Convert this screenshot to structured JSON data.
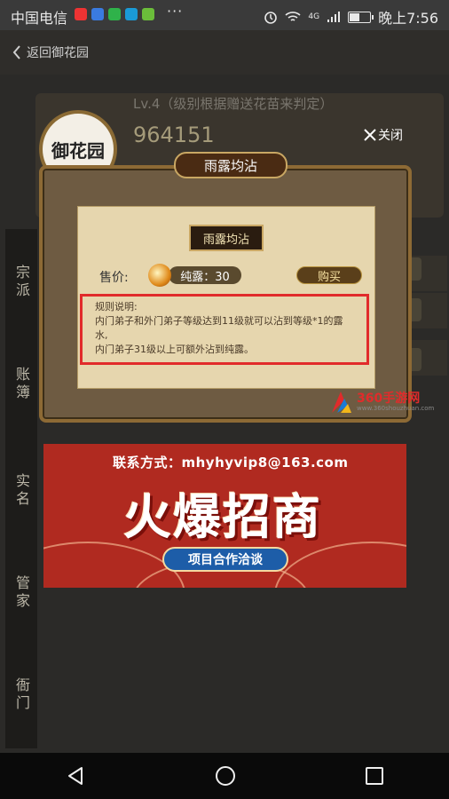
{
  "status_bar": {
    "carrier": "中国电信",
    "network": "4G",
    "time": "晚上7:56"
  },
  "header": {
    "back_label": "返回御花园"
  },
  "profile": {
    "level_text": "Lv.4（级别根据赠送花苗来判定）",
    "score": "964151",
    "avatar_text": "御花园"
  },
  "dialog": {
    "title": "雨露均沾",
    "subtitle": "雨露均沾",
    "close_label": "关闭",
    "price_label": "售价:",
    "price_value": "纯露：30",
    "buy_label": "购买",
    "rules_title": "规则说明:",
    "rules_line1": "内门弟子和外门弟子等级达到11级就可以沾到等级*1的露水,",
    "rules_line2": "内门弟子31级以上可额外沾到纯露。"
  },
  "side_nav": [
    "宗派",
    "账簿",
    "实名",
    "管家",
    "衙门"
  ],
  "watermark": {
    "name": "360手游网",
    "url": "www.360shouzhuan.com"
  },
  "ad": {
    "contact": "联系方式：mhyhyvip8@163.com",
    "headline": "火爆招商",
    "cta": "项目合作洽谈"
  },
  "colors": {
    "accent_red": "#e12b2b",
    "dialog_brown": "#6e5b42",
    "parchment": "#e6d6ae"
  }
}
